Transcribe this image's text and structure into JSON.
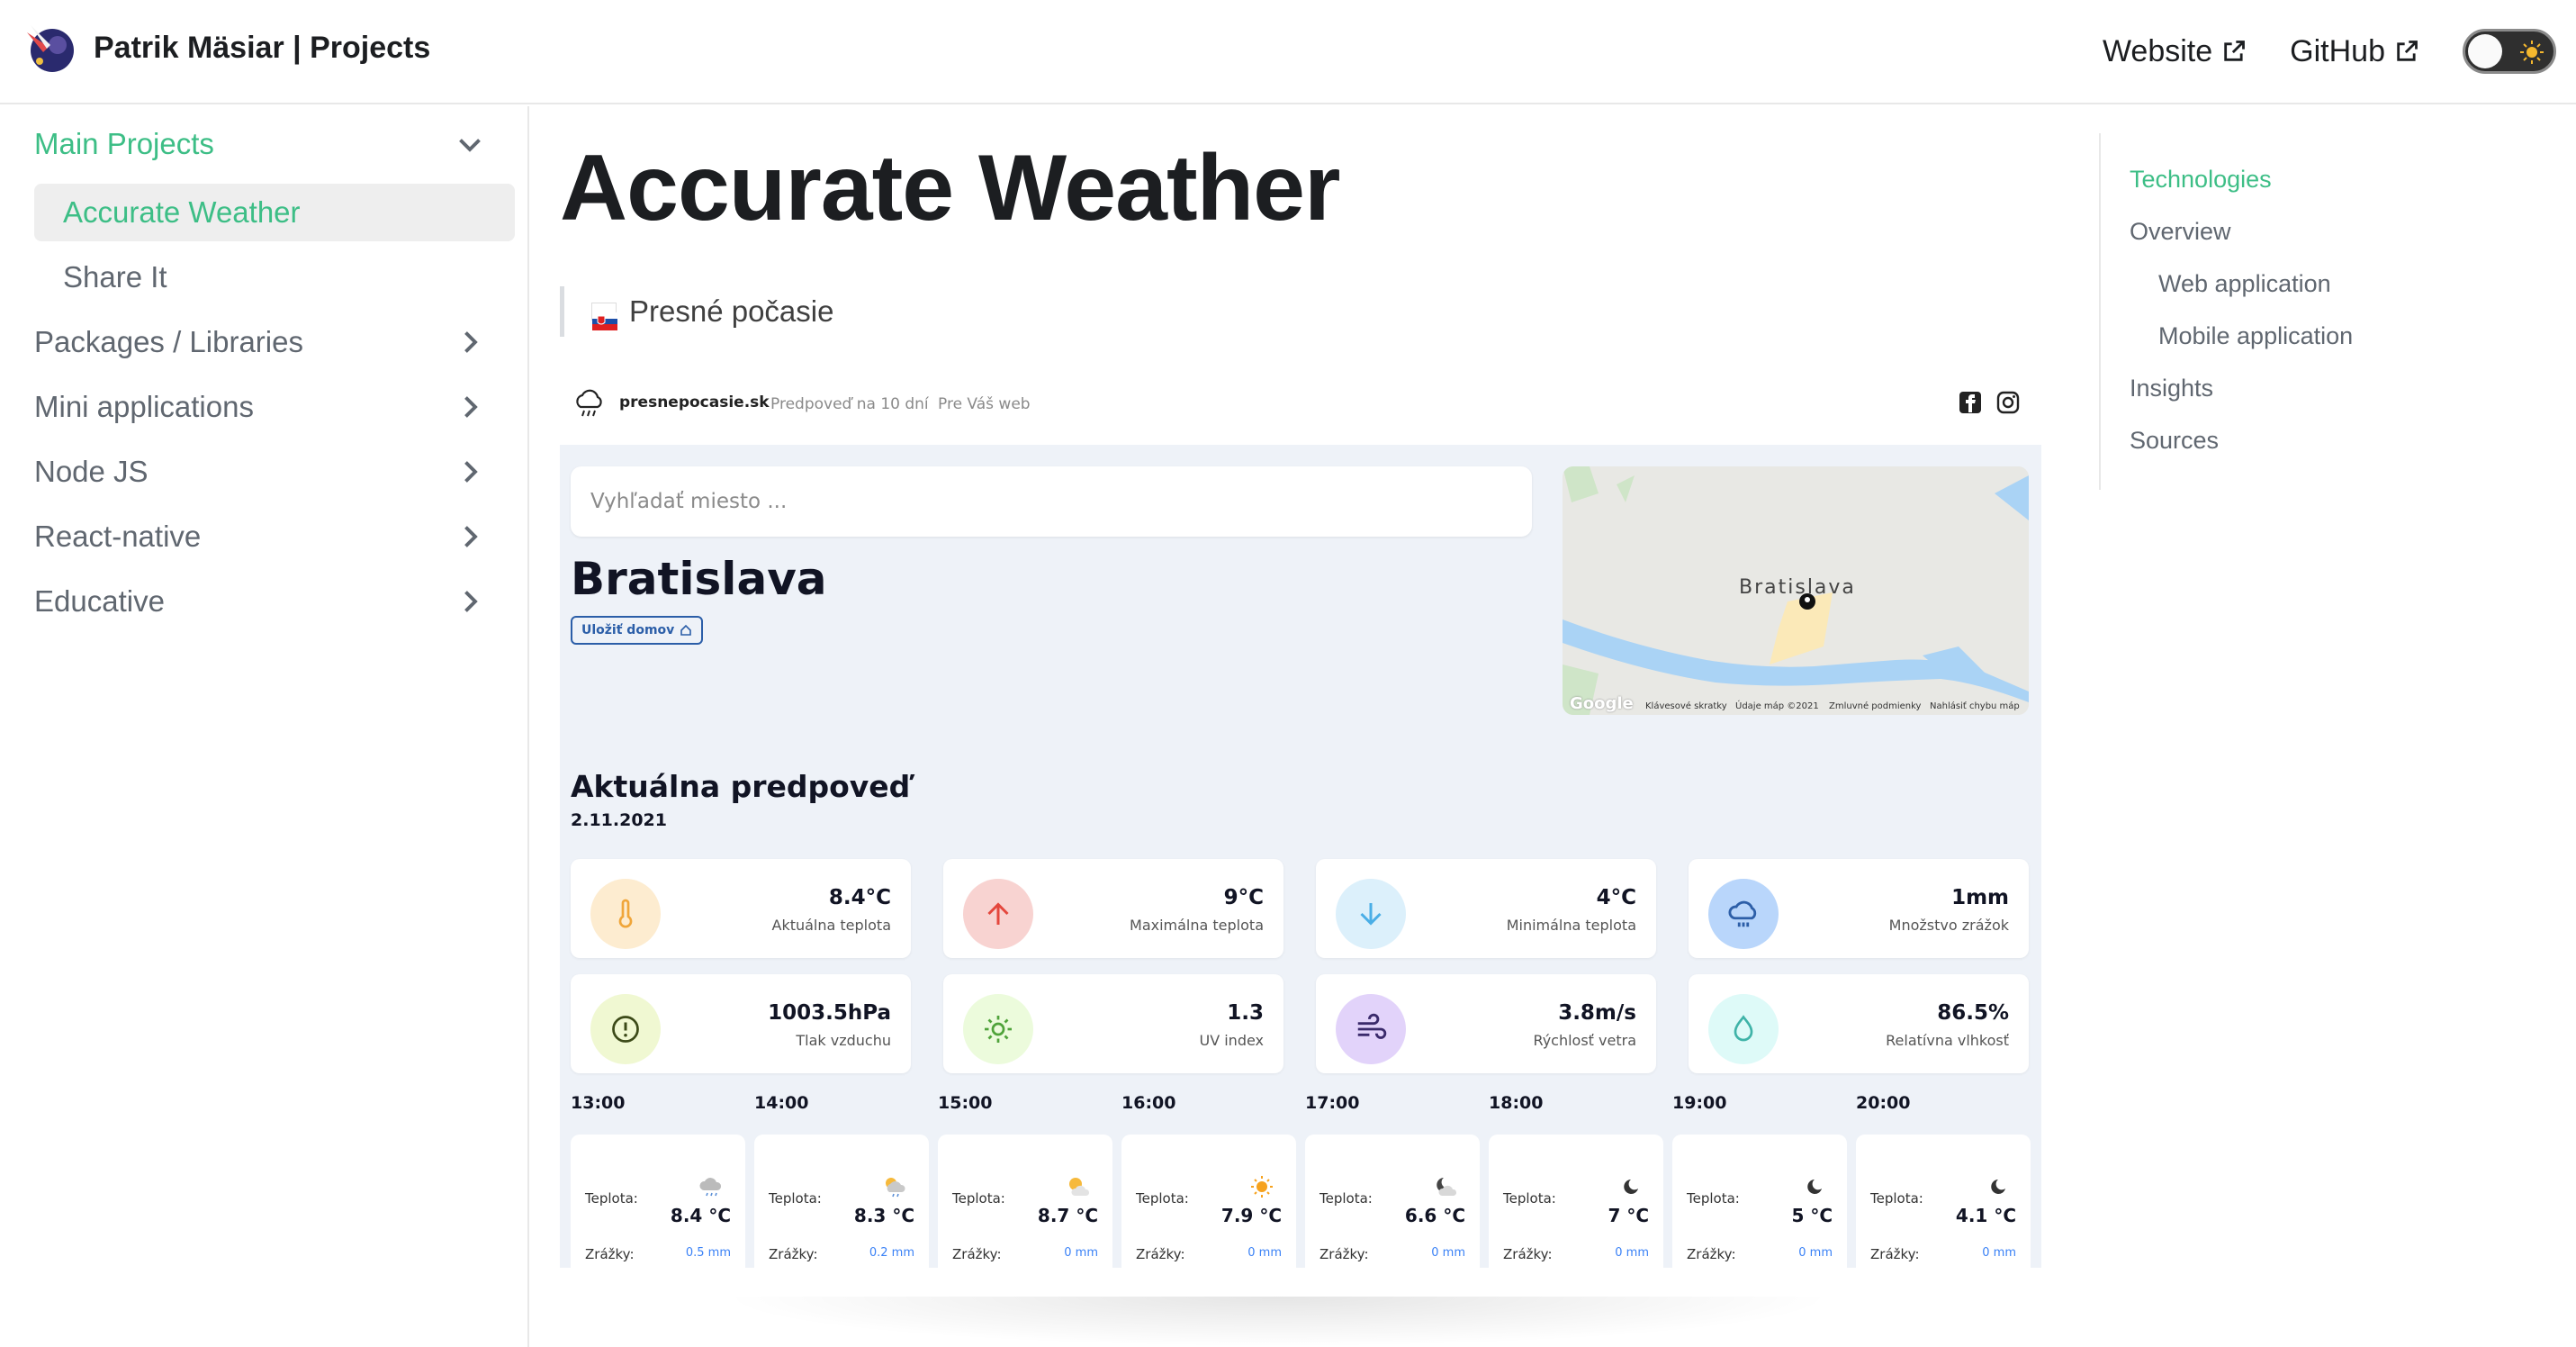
{
  "header": {
    "title": "Patrik Mäsiar | Projects",
    "links": [
      {
        "label": "Website"
      },
      {
        "label": "GitHub"
      }
    ]
  },
  "sidebar": {
    "items": [
      {
        "label": "Main Projects",
        "expanded": true,
        "active": true
      },
      {
        "label": "Accurate Weather",
        "active": true,
        "sub": true
      },
      {
        "label": "Share It",
        "sub": true
      },
      {
        "label": "Packages / Libraries"
      },
      {
        "label": "Mini applications"
      },
      {
        "label": "Node JS"
      },
      {
        "label": "React-native"
      },
      {
        "label": "Educative"
      }
    ]
  },
  "main": {
    "title": "Accurate Weather",
    "quote": "Presné počasie"
  },
  "screenshot": {
    "brand": "presnepocasie.sk",
    "nav": [
      "Predpoveď na 10 dní",
      "Pre Váš web"
    ],
    "search_placeholder": "Vyhľadať miesto ...",
    "city": "Bratislava",
    "home_button": "Uložiť domov",
    "map": {
      "label": "Bratislava",
      "google": "Google",
      "footer": [
        "Klávesové skratky",
        "Údaje máp ©2021",
        "Zmluvné podmienky",
        "Nahlásiť chybu máp"
      ]
    },
    "section_title": "Aktuálna predpoveď",
    "date": "2.11.2021",
    "cards": [
      {
        "value": "8.4°C",
        "label": "Aktuálna teplota",
        "icon": "thermometer-icon",
        "color": "#fdecd0",
        "stroke": "#f0a63a"
      },
      {
        "value": "9°C",
        "label": "Maximálna teplota",
        "icon": "arrow-up-icon",
        "color": "#f8d3d1",
        "stroke": "#e4473d"
      },
      {
        "value": "4°C",
        "label": "Minimálna teplota",
        "icon": "arrow-down-icon",
        "color": "#dcf0fb",
        "stroke": "#4aaee6"
      },
      {
        "value": "1mm",
        "label": "Množstvo zrážok",
        "icon": "rain-cloud-icon",
        "color": "#b9d6fb",
        "stroke": "#2d5fa8"
      },
      {
        "value": "1003.5hPa",
        "label": "Tlak vzduchu",
        "icon": "pressure-icon",
        "color": "#f0f8d2",
        "stroke": "#3c4a18"
      },
      {
        "value": "1.3",
        "label": "UV index",
        "icon": "sun-icon",
        "color": "#ecfbdc",
        "stroke": "#4fa33a"
      },
      {
        "value": "3.8m/s",
        "label": "Rýchlosť vetra",
        "icon": "wind-icon",
        "color": "#e2d3fa",
        "stroke": "#3a2a6b"
      },
      {
        "value": "86.5%",
        "label": "Relatívna vlhkosť",
        "icon": "droplet-icon",
        "color": "#defaf8",
        "stroke": "#3fb3a8"
      }
    ],
    "hours": [
      {
        "time": "13:00",
        "temp_label": "Teplota:",
        "temp": "8.4 °C",
        "rain_label": "Zrážky:",
        "rain": "0.5 mm",
        "icon": "rain-cloud-icon"
      },
      {
        "time": "14:00",
        "temp_label": "Teplota:",
        "temp": "8.3 °C",
        "rain_label": "Zrážky:",
        "rain": "0.2 mm",
        "icon": "sun-rain-icon"
      },
      {
        "time": "15:00",
        "temp_label": "Teplota:",
        "temp": "8.7 °C",
        "rain_label": "Zrážky:",
        "rain": "0 mm",
        "icon": "sun-cloud-icon"
      },
      {
        "time": "16:00",
        "temp_label": "Teplota:",
        "temp": "7.9 °C",
        "rain_label": "Zrážky:",
        "rain": "0 mm",
        "icon": "sun-icon"
      },
      {
        "time": "17:00",
        "temp_label": "Teplota:",
        "temp": "6.6 °C",
        "rain_label": "Zrážky:",
        "rain": "0 mm",
        "icon": "moon-cloud-icon"
      },
      {
        "time": "18:00",
        "temp_label": "Teplota:",
        "temp": "7 °C",
        "rain_label": "Zrážky:",
        "rain": "0 mm",
        "icon": "moon-icon"
      },
      {
        "time": "19:00",
        "temp_label": "Teplota:",
        "temp": "5 °C",
        "rain_label": "Zrážky:",
        "rain": "0 mm",
        "icon": "moon-icon"
      },
      {
        "time": "20:00",
        "temp_label": "Teplota:",
        "temp": "4.1 °C",
        "rain_label": "Zrážky:",
        "rain": "0 mm",
        "icon": "moon-icon"
      }
    ]
  },
  "toc": {
    "items": [
      {
        "label": "Technologies",
        "active": true
      },
      {
        "label": "Overview"
      },
      {
        "label": "Web application",
        "sub": true
      },
      {
        "label": "Mobile application",
        "sub": true
      },
      {
        "label": "Insights"
      },
      {
        "label": "Sources"
      }
    ]
  },
  "colors": {
    "accent": "#3dbe86",
    "text": "#1c1e21",
    "muted": "#606770"
  }
}
